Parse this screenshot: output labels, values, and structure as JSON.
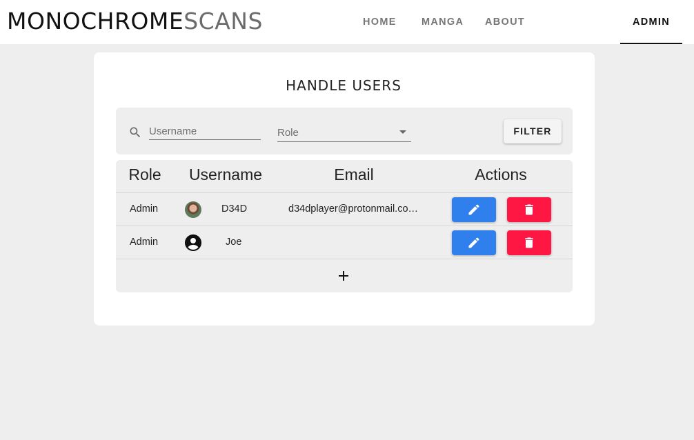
{
  "brand": {
    "part1": "MONOCHROME",
    "part2": "SCANS"
  },
  "nav": {
    "home": "HOME",
    "manga": "MANGA",
    "about": "ABOUT",
    "admin": "ADMIN"
  },
  "page": {
    "title": "HANDLE USERS"
  },
  "filters": {
    "username_placeholder": "Username",
    "role_placeholder": "Role",
    "filter_button": "FILTER"
  },
  "table": {
    "headers": {
      "role": "Role",
      "username": "Username",
      "email": "Email",
      "actions": "Actions"
    },
    "rows": [
      {
        "role": "Admin",
        "username": "D34D",
        "email": "d34dplayer@protonmail.co…",
        "avatar": "user-photo"
      },
      {
        "role": "Admin",
        "username": "Joe",
        "email": "",
        "avatar": "default-account-icon"
      }
    ]
  },
  "icons": {
    "search": "search-icon",
    "edit": "pencil-icon",
    "delete": "trash-icon",
    "add": "plus-icon",
    "dropdown": "chevron-down-icon"
  },
  "colors": {
    "edit_button": "#2f80ed",
    "delete_button": "#ff1744",
    "background": "#eeeeee"
  }
}
